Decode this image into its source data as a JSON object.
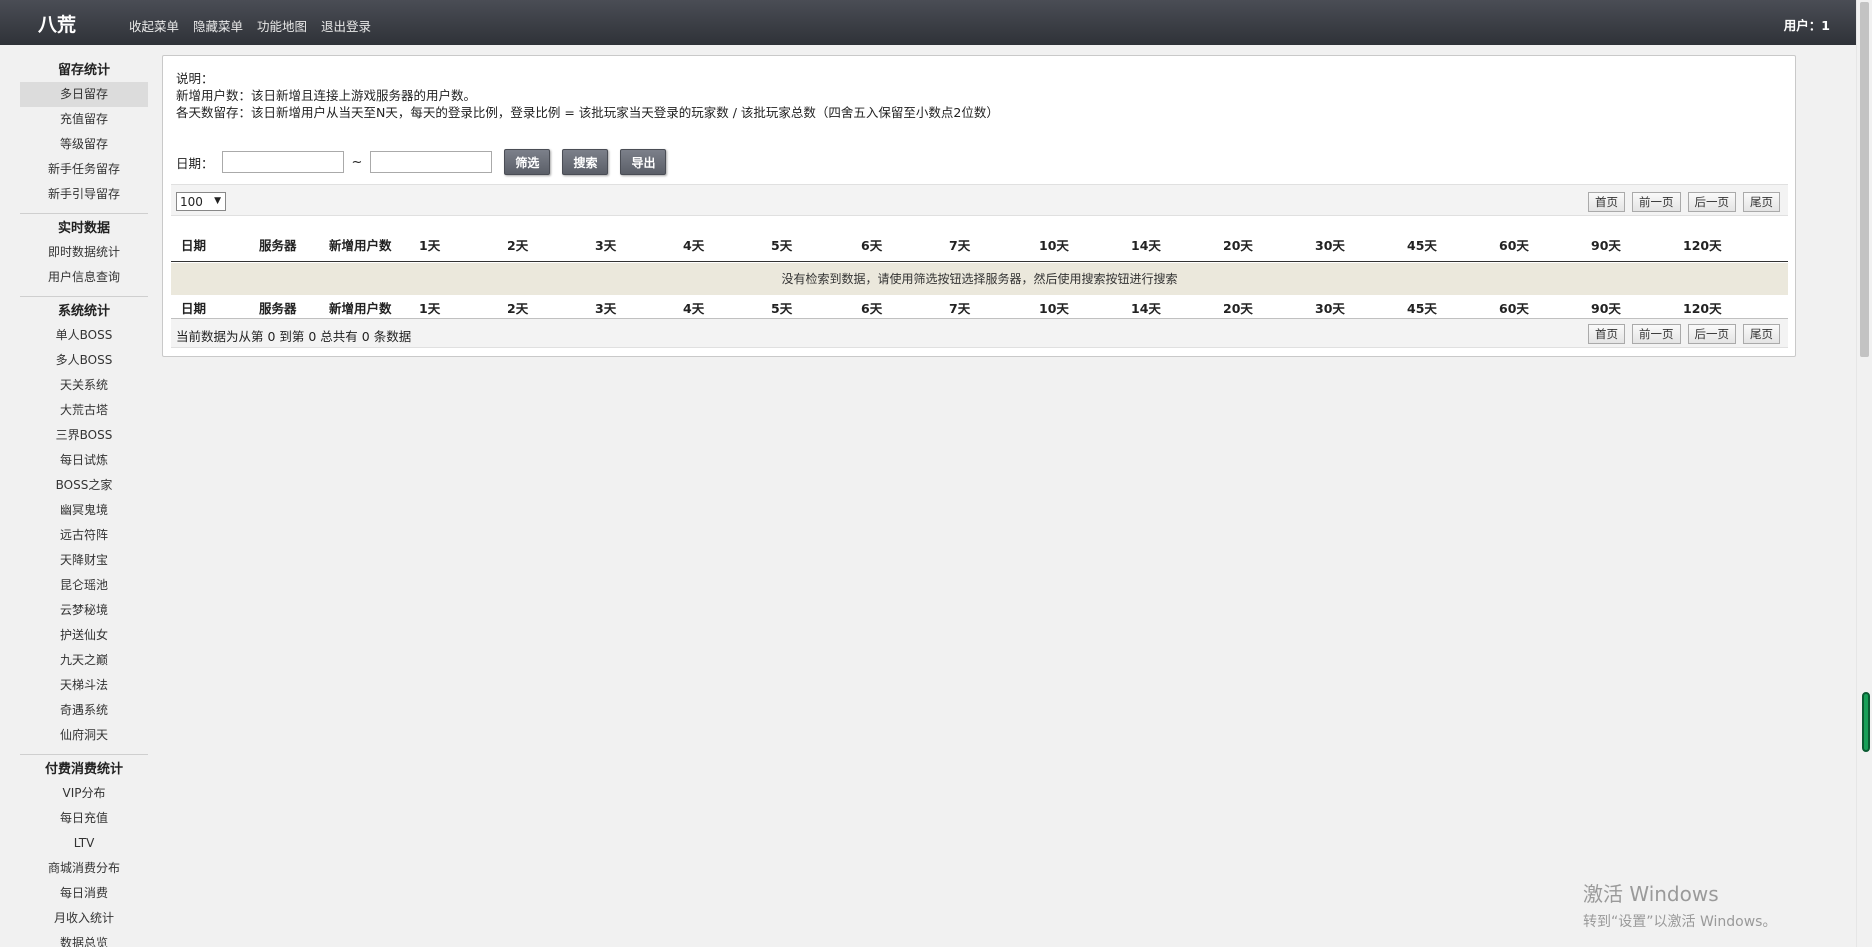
{
  "brand": "八荒",
  "top_nav": [
    "收起菜单",
    "隐藏菜单",
    "功能地图",
    "退出登录"
  ],
  "user_label": "用户：1",
  "sidebar": {
    "groups": [
      {
        "title": "留存统计",
        "items": [
          "多日留存",
          "充值留存",
          "等级留存",
          "新手任务留存",
          "新手引导留存"
        ]
      },
      {
        "title": "实时数据",
        "items": [
          "即时数据统计",
          "用户信息查询"
        ]
      },
      {
        "title": "系统统计",
        "items": [
          "单人BOSS",
          "多人BOSS",
          "天关系统",
          "大荒古塔",
          "三界BOSS",
          "每日试炼",
          "BOSS之家",
          "幽冥鬼境",
          "远古符阵",
          "天降财宝",
          "昆仑瑶池",
          "云梦秘境",
          "护送仙女",
          "九天之巅",
          "天梯斗法",
          "奇遇系统",
          "仙府洞天"
        ]
      },
      {
        "title": "付费消费统计",
        "items": [
          "VIP分布",
          "每日充值",
          "LTV",
          "商城消费分布",
          "每日消费",
          "月收入统计",
          "数据总览"
        ]
      }
    ],
    "active": "多日留存"
  },
  "description": {
    "title": "说明：",
    "line1": "新增用户数：该日新增且连接上游戏服务器的用户数。",
    "line2": "各天数留存：该日新增用户从当天至N天，每天的登录比例，登录比例 = 该批玩家当天登录的玩家数 / 该批玩家总数（四舍五入保留至小数点2位数）"
  },
  "filter": {
    "date_label": "日期：",
    "start_value": "",
    "end_value": "",
    "separator": "~",
    "buttons": [
      "筛选",
      "搜索",
      "导出"
    ]
  },
  "page_size": "100",
  "pager": [
    "首页",
    "前一页",
    "后一页",
    "尾页"
  ],
  "table": {
    "columns": [
      "日期",
      "服务器",
      "新增用户数",
      "1天",
      "2天",
      "3天",
      "4天",
      "5天",
      "6天",
      "7天",
      "10天",
      "14天",
      "20天",
      "30天",
      "45天",
      "60天",
      "90天",
      "120天"
    ],
    "empty_message": "没有检索到数据，请使用筛选按钮选择服务器，然后使用搜索按钮进行搜索"
  },
  "info_text": "当前数据为从第 0 到第 0 总共有 0 条数据",
  "watermark": {
    "line1": "激活 Windows",
    "line2": "转到“设置”以激活 Windows。"
  }
}
